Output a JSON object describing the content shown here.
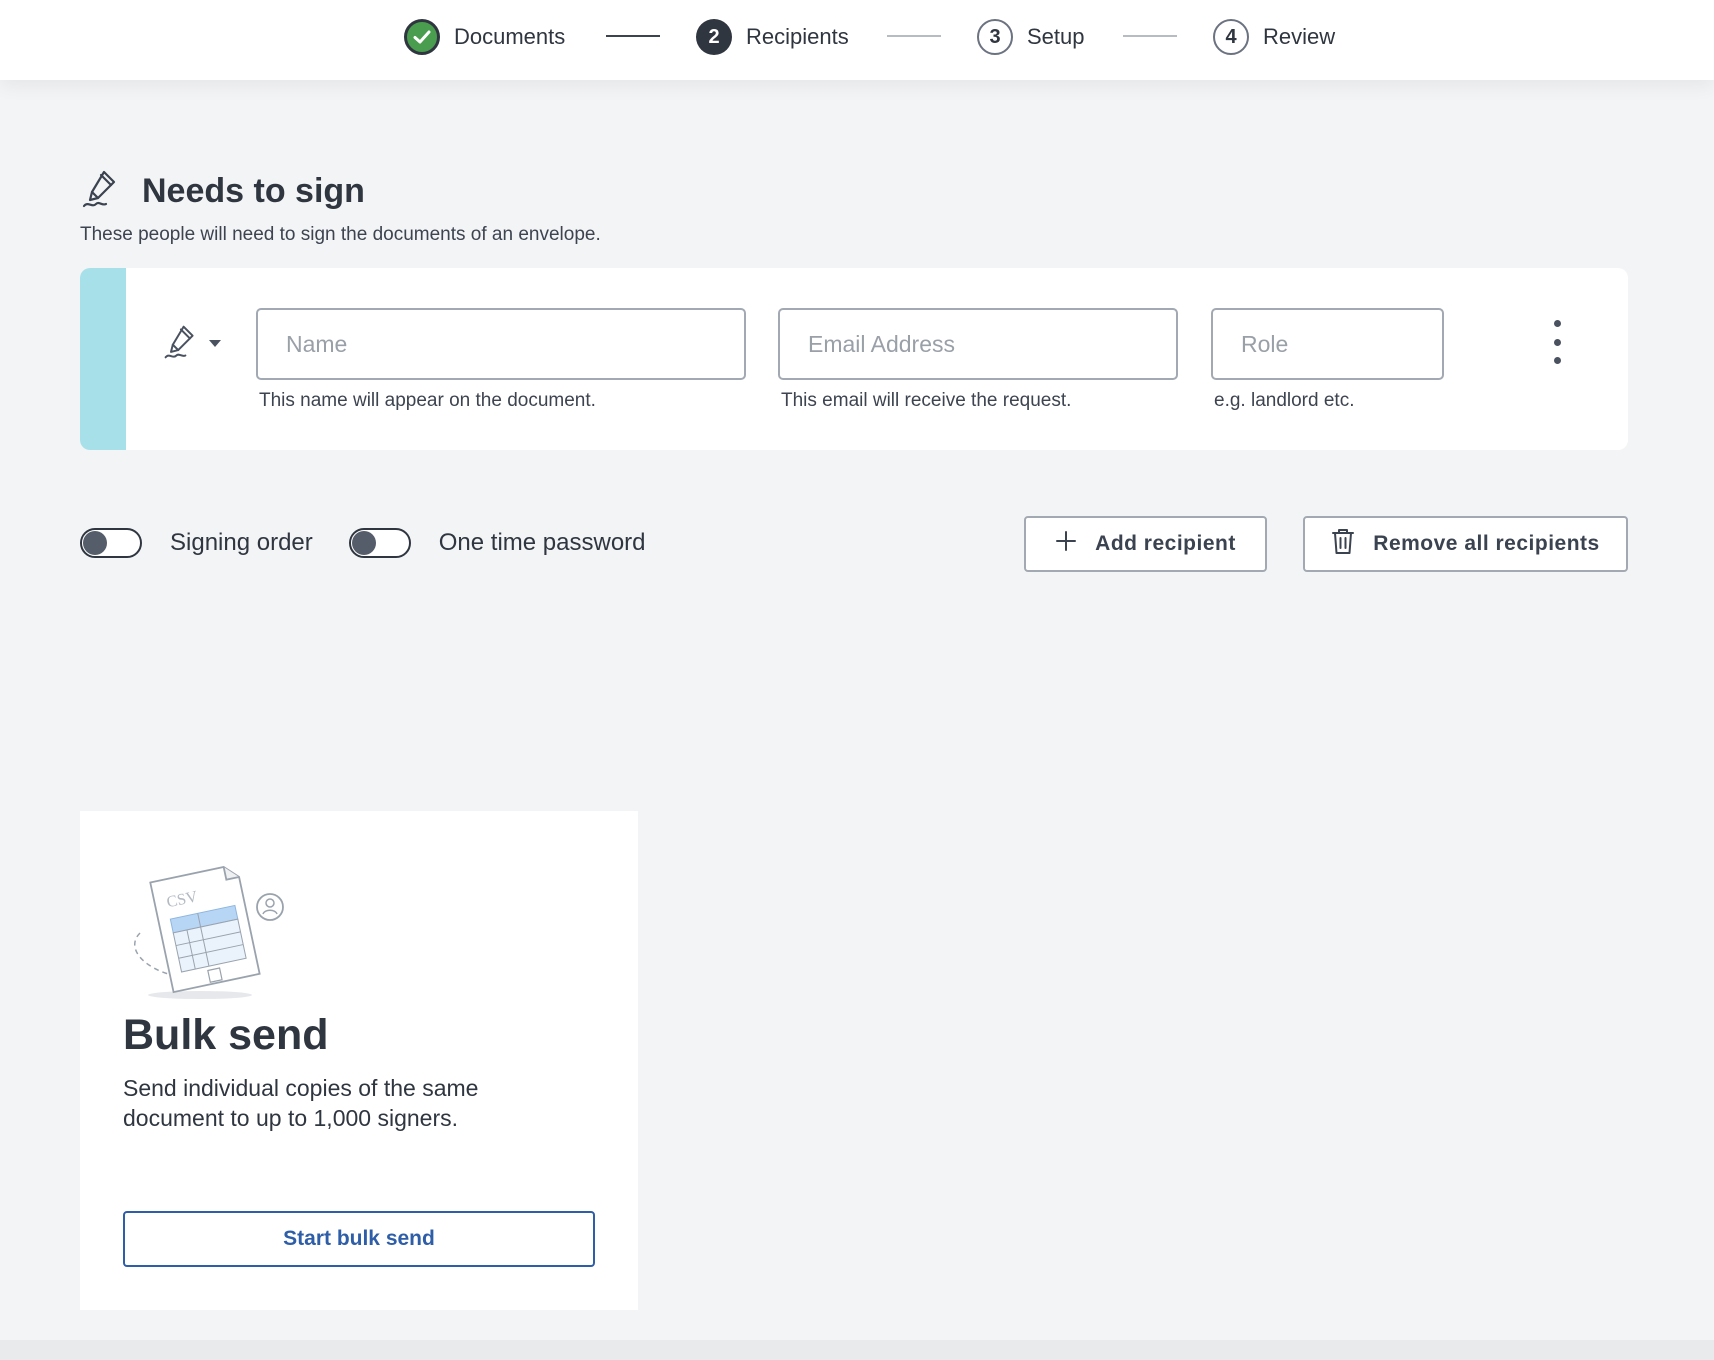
{
  "stepper": {
    "steps": [
      {
        "number": "",
        "label": "Documents",
        "state": "done"
      },
      {
        "number": "2",
        "label": "Recipients",
        "state": "current"
      },
      {
        "number": "3",
        "label": "Setup",
        "state": "todo"
      },
      {
        "number": "4",
        "label": "Review",
        "state": "todo"
      }
    ]
  },
  "section": {
    "icon": "pen-sign-icon",
    "title": "Needs to sign",
    "description": "These people will need to sign the documents of an envelope."
  },
  "recipient": {
    "signer_icon": "pen-sign-icon",
    "name": {
      "value": "",
      "placeholder": "Name",
      "hint": "This name will appear on the document."
    },
    "email": {
      "value": "",
      "placeholder": "Email Address",
      "hint": "This email will receive the request."
    },
    "role": {
      "value": "",
      "placeholder": "Role",
      "hint": "e.g. landlord etc."
    },
    "accent_color": "#a8e0ea"
  },
  "options": {
    "signing_order": {
      "label": "Signing order",
      "enabled": false
    },
    "one_time_password": {
      "label": "One time password",
      "enabled": false
    }
  },
  "actions": {
    "add_recipient": "Add recipient",
    "remove_all": "Remove all recipients"
  },
  "bulk_send": {
    "illustration_text": "CSV",
    "title": "Bulk send",
    "description": "Send individual copies of the same document to up to 1,000 signers.",
    "button": "Start bulk send"
  }
}
